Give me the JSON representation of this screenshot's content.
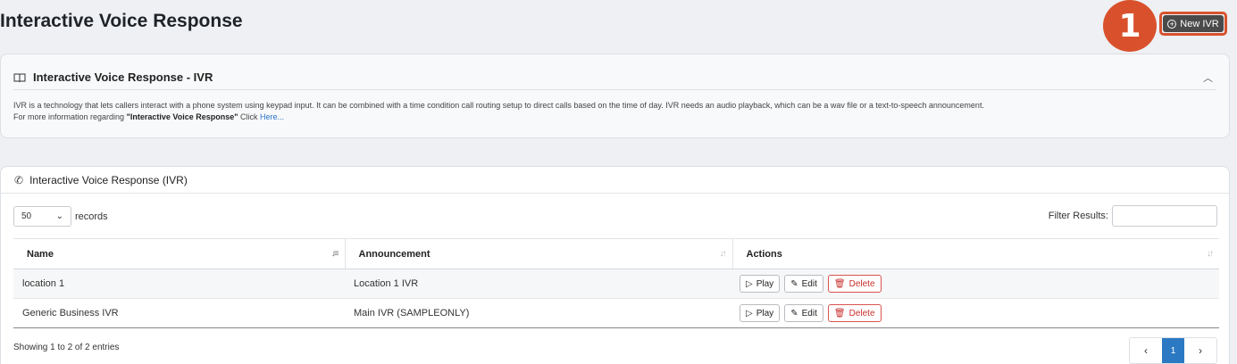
{
  "page": {
    "title": "Interactive Voice Response"
  },
  "annotation": {
    "step_number": "1",
    "color": "#d9512c"
  },
  "toolbar": {
    "new_ivr_label": "New IVR"
  },
  "info_panel": {
    "title": "Interactive Voice Response - IVR",
    "description": "IVR is a technology that lets callers interact with a phone system using keypad input. It can be combined with a time condition call routing setup to direct calls based on the time of day. IVR needs an audio playback, which can be a wav file or a text-to-speech announcement.",
    "more_info_prefix": "For more information regarding",
    "more_info_topic": "\"Interactive Voice Response\"",
    "click_text": "Click",
    "link_text": "Here..."
  },
  "table_panel": {
    "title": "Interactive Voice Response (IVR)",
    "records_value": "50",
    "records_label": "records",
    "filter_label": "Filter Results:",
    "filter_value": "",
    "columns": [
      "Name",
      "Announcement",
      "Actions"
    ],
    "rows": [
      {
        "name": "location 1",
        "announcement": "Location 1 IVR"
      },
      {
        "name": "Generic Business IVR",
        "announcement": "Main IVR (SAMPLEONLY)"
      }
    ],
    "action_labels": {
      "play": "Play",
      "edit": "Edit",
      "delete": "Delete"
    },
    "summary": "Showing 1 to 2 of 2 entries",
    "pagination": {
      "prev": "‹",
      "current": "1",
      "next": "›"
    }
  },
  "colors": {
    "accent": "#2b79c2",
    "danger": "#d9534f",
    "primary_button": "#4a4a4a"
  }
}
